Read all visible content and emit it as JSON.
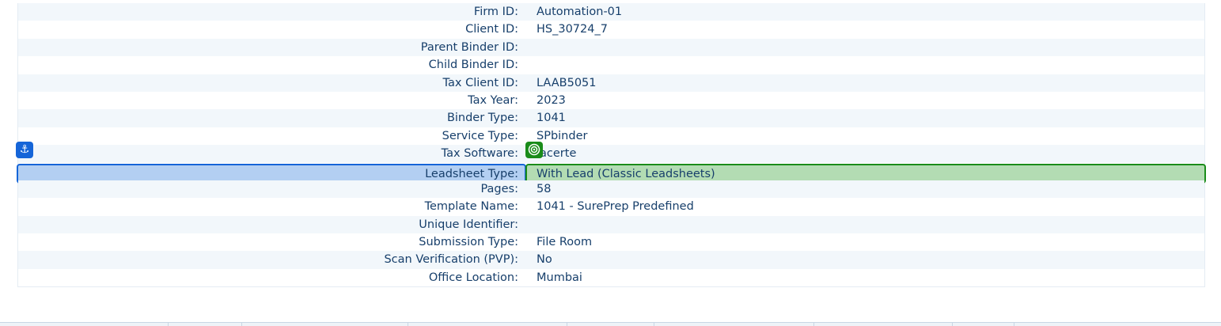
{
  "details": {
    "rows": [
      {
        "label": "Firm ID:",
        "value": "Automation-01"
      },
      {
        "label": "Client ID:",
        "value": "HS_30724_7"
      },
      {
        "label": "Parent Binder ID:",
        "value": ""
      },
      {
        "label": "Child Binder ID:",
        "value": ""
      },
      {
        "label": "Tax Client ID:",
        "value": "LAAB5051"
      },
      {
        "label": "Tax Year:",
        "value": "2023"
      },
      {
        "label": "Binder Type:",
        "value": "1041"
      },
      {
        "label": "Service Type:",
        "value": "SPbinder"
      },
      {
        "label": "Tax Software:",
        "value": "lacerte"
      },
      {
        "label": "Leadsheet Type:",
        "value": "With Lead (Classic Leadsheets)"
      },
      {
        "label": "Pages:",
        "value": "58"
      },
      {
        "label": "Template Name:",
        "value": "1041 - SurePrep Predefined"
      },
      {
        "label": "Unique Identifier:",
        "value": ""
      },
      {
        "label": "Submission Type:",
        "value": "File Room"
      },
      {
        "label": "Scan Verification (PVP):",
        "value": "No"
      },
      {
        "label": "Office Location:",
        "value": "Mumbai"
      }
    ]
  },
  "overlay": {
    "anchor_icon": "anchor-icon",
    "target_icon": "target-icon",
    "anchor_color": "#1565d8",
    "target_color": "#1a8c1a"
  }
}
